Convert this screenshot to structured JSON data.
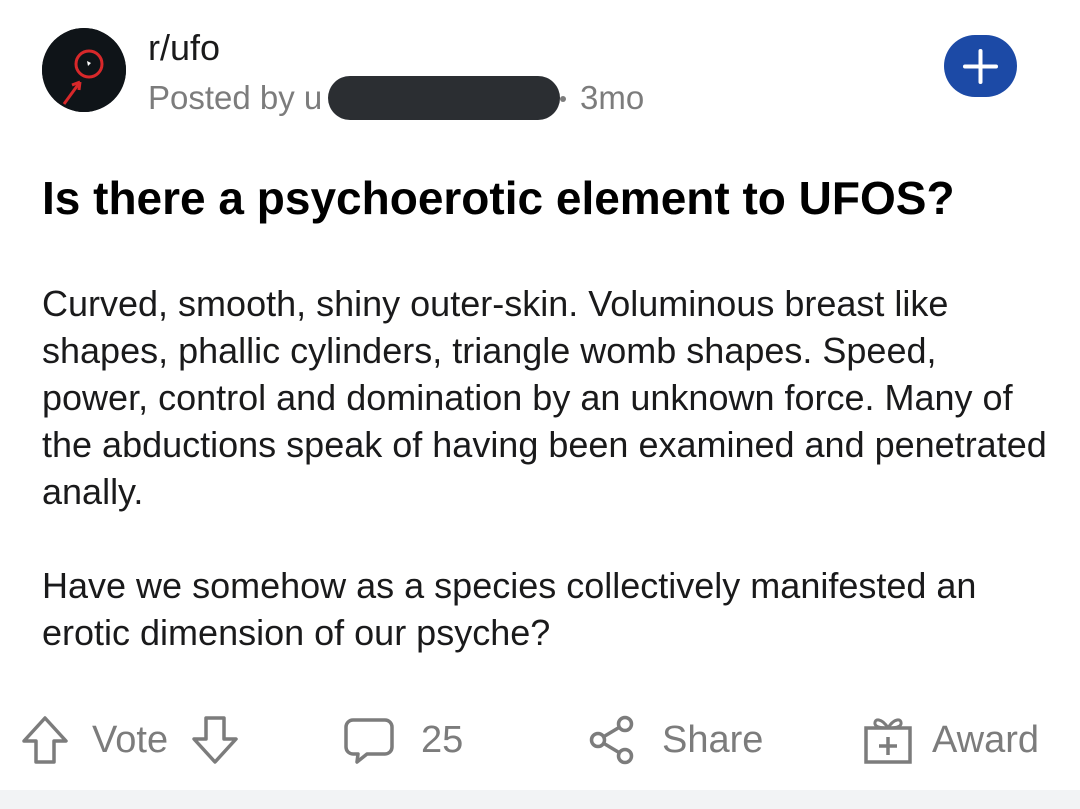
{
  "post": {
    "subreddit": "r/ufo",
    "posted_by_prefix": "Posted by u",
    "age": "3mo",
    "title": "Is there a psychoerotic element to UFOS?",
    "body": [
      "Curved, smooth, shiny outer-skin. Voluminous breast like shapes, phallic cylinders, triangle womb shapes. Speed, power, control and domination by an unknown force. Many of the abductions speak of having been examined and penetrated anally.",
      "Have we somehow as a species collectively manifested an erotic dimension of our psyche?"
    ]
  },
  "actions": {
    "vote_label": "Vote",
    "comment_count": "25",
    "share_label": "Share",
    "award_label": "Award"
  },
  "icons": {
    "join": "plus-icon",
    "upvote": "arrow-up-icon",
    "downvote": "arrow-down-icon",
    "comment": "speech-bubble-icon",
    "share": "share-icon",
    "award": "gift-icon"
  },
  "colors": {
    "join_button": "#1c4aa6",
    "meta_text": "#7c7c7c",
    "redaction": "#2b2e32"
  }
}
